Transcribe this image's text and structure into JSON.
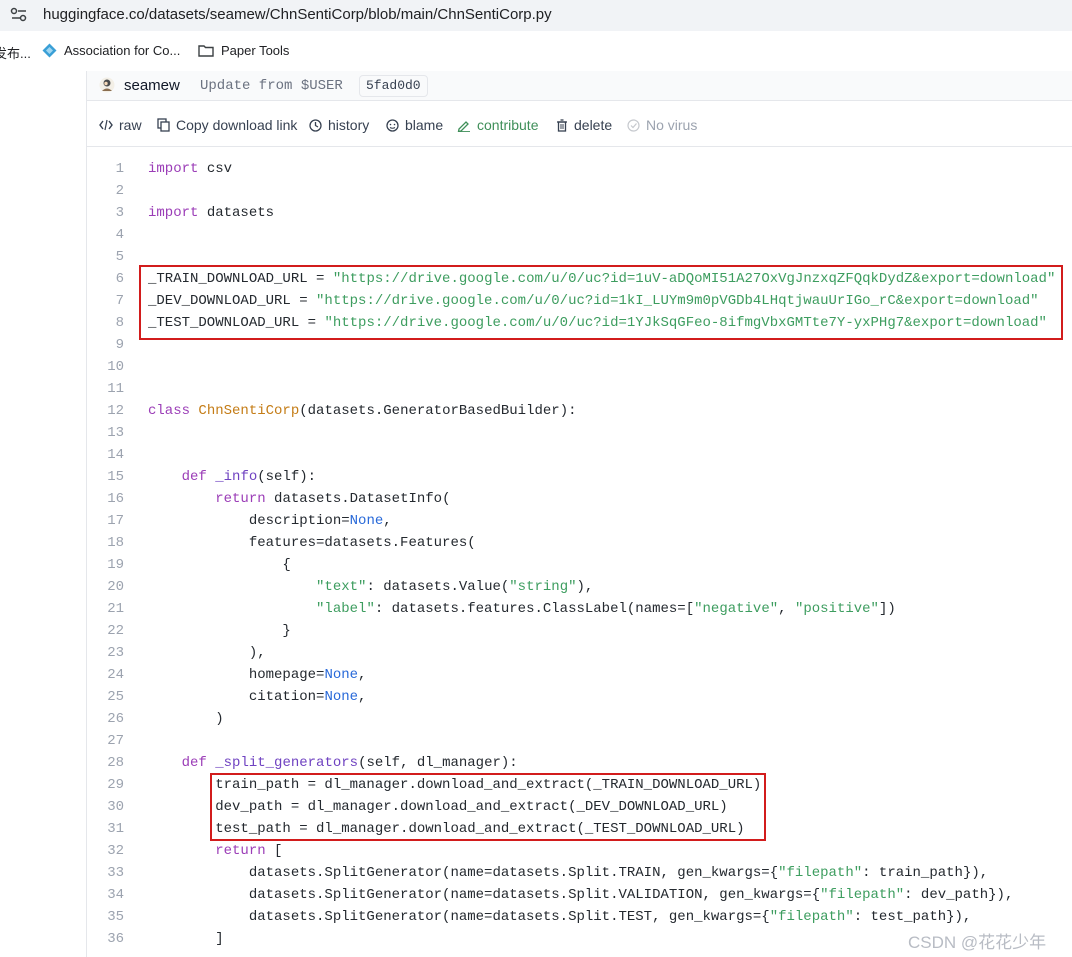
{
  "browser": {
    "url": "huggingface.co/datasets/seamew/ChnSentiCorp/blob/main/ChnSentiCorp.py",
    "site_icon": "site-settings-icon",
    "bookmarks": [
      {
        "label": "发布...",
        "icon": "none"
      },
      {
        "label": "Association for Co...",
        "icon": "diamond-logo-icon"
      },
      {
        "label": "Paper Tools",
        "icon": "folder-icon"
      }
    ]
  },
  "commit": {
    "author": "seamew",
    "message": "Update from $USER",
    "hash": "5fad0d0"
  },
  "toolbar": {
    "raw": "raw",
    "copy_link": "Copy download link",
    "history": "history",
    "blame": "blame",
    "contribute": "contribute",
    "delete": "delete",
    "no_virus": "No virus"
  },
  "code": {
    "line_numbers": [
      "1",
      "2",
      "3",
      "4",
      "5",
      "6",
      "7",
      "8",
      "9",
      "10",
      "11",
      "12",
      "13",
      "14",
      "15",
      "16",
      "17",
      "18",
      "19",
      "20",
      "21",
      "22",
      "23",
      "24",
      "25",
      "26",
      "27",
      "28",
      "29",
      "30",
      "31",
      "32",
      "33",
      "34",
      "35",
      "36"
    ],
    "lines": [
      "import csv",
      "",
      "import datasets",
      "",
      "",
      "_TRAIN_DOWNLOAD_URL = \"https://drive.google.com/u/0/uc?id=1uV-aDQoMI51A27OxVgJnzxqZFQqkDydZ&export=download\"",
      "_DEV_DOWNLOAD_URL = \"https://drive.google.com/u/0/uc?id=1kI_LUYm9m0pVGDb4LHqtjwauUrIGo_rC&export=download\"",
      "_TEST_DOWNLOAD_URL = \"https://drive.google.com/u/0/uc?id=1YJkSqGFeo-8ifmgVbxGMTte7Y-yxPHg7&export=download\"",
      "",
      "",
      "",
      "class ChnSentiCorp(datasets.GeneratorBasedBuilder):",
      "",
      "",
      "    def _info(self):",
      "        return datasets.DatasetInfo(",
      "            description=None,",
      "            features=datasets.Features(",
      "                {",
      "                    \"text\": datasets.Value(\"string\"),",
      "                    \"label\": datasets.features.ClassLabel(names=[\"negative\", \"positive\"])",
      "                }",
      "            ),",
      "            homepage=None,",
      "            citation=None,",
      "        )",
      "",
      "    def _split_generators(self, dl_manager):",
      "        train_path = dl_manager.download_and_extract(_TRAIN_DOWNLOAD_URL)",
      "        dev_path = dl_manager.download_and_extract(_DEV_DOWNLOAD_URL)",
      "        test_path = dl_manager.download_and_extract(_TEST_DOWNLOAD_URL)",
      "        return [",
      "            datasets.SplitGenerator(name=datasets.Split.TRAIN, gen_kwargs={\"filepath\": train_path}),",
      "            datasets.SplitGenerator(name=datasets.Split.VALIDATION, gen_kwargs={\"filepath\": dev_path}),",
      "            datasets.SplitGenerator(name=datasets.Split.TEST, gen_kwargs={\"filepath\": test_path}),",
      "        ]"
    ]
  },
  "colors": {
    "keyword": "#9b3db7",
    "class_name": "#c47c16",
    "string": "#3d9d5f",
    "constant": "#2869d9",
    "highlight_box": "#d21c1c"
  },
  "watermark": "CSDN @花花少年"
}
